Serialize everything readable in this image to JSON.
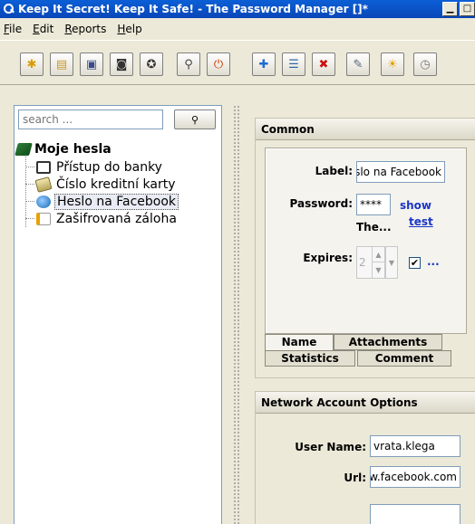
{
  "window": {
    "title": "Keep It Secret! Keep It Safe! - The Password Manager []*"
  },
  "menu": [
    {
      "label": "File",
      "key": "F",
      "rest": "ile"
    },
    {
      "label": "Edit",
      "key": "E",
      "rest": "dit"
    },
    {
      "label": "Reports",
      "key": "R",
      "rest": "eports"
    },
    {
      "label": "Help",
      "key": "H",
      "rest": "elp"
    }
  ],
  "toolbar": {
    "buttons": [
      {
        "name": "new-file-icon",
        "glyph": "✱",
        "color": "#d89b00"
      },
      {
        "name": "open-folder-icon",
        "glyph": "▤",
        "color": "#c99a2e"
      },
      {
        "name": "save-icon",
        "glyph": "▣",
        "color": "#3a4a8a"
      },
      {
        "name": "save-as-icon",
        "glyph": "◙",
        "color": "#333333"
      },
      {
        "name": "lifebuoy-icon",
        "glyph": "✪",
        "color": "#333333"
      },
      {
        "name": "search-key-icon",
        "glyph": "⚲",
        "color": "#444444"
      },
      {
        "name": "exit-icon",
        "glyph": "⏻",
        "color": "#cc3b00"
      },
      {
        "name": "add-entry-icon",
        "glyph": "✚",
        "color": "#1e6ad0"
      },
      {
        "name": "list-icon",
        "glyph": "☰",
        "color": "#3366aa"
      },
      {
        "name": "delete-icon",
        "glyph": "✖",
        "color": "#cc1111"
      },
      {
        "name": "edit-icon",
        "glyph": "✎",
        "color": "#556677"
      },
      {
        "name": "bulb-icon",
        "glyph": "☀",
        "color": "#e0a000"
      },
      {
        "name": "clock-icon",
        "glyph": "◷",
        "color": "#777777"
      }
    ]
  },
  "search": {
    "placeholder": "search ..."
  },
  "tree": {
    "root": "Moje hesla",
    "items": [
      {
        "label": "Přístup do banky",
        "icon": "bank-icon"
      },
      {
        "label": "Číslo kreditní karty",
        "icon": "card-icon"
      },
      {
        "label": "Heslo na Facebook",
        "icon": "globe-icon",
        "selected": true
      },
      {
        "label": "Zašifrovaná záloha",
        "icon": "document-icon"
      }
    ]
  },
  "common": {
    "header": "Common",
    "label_label": "Label:",
    "label_value": "Heslo na Facebook",
    "password_label": "Password:",
    "password_value": "****",
    "show_link": "show",
    "test_link": "test",
    "strength_text": "The...",
    "expires_label": "Expires:",
    "expires_value": "2",
    "expires_enabled": true,
    "more_link": "...",
    "tabs_row1": [
      "Name",
      "Attachments"
    ],
    "tabs_row2": [
      "Statistics",
      "Comment"
    ]
  },
  "network": {
    "header": "Network Account Options",
    "username_label": "User Name:",
    "username_value": "vrata.klega",
    "url_label": "Url:",
    "url_value": "www.facebook.com"
  }
}
